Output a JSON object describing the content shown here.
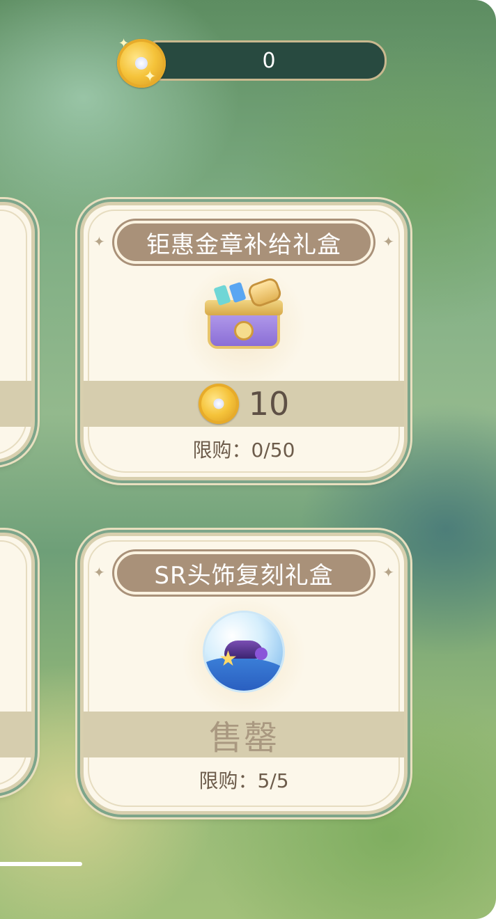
{
  "currency": {
    "balance": "0",
    "icon": "gold-coin-icon"
  },
  "shop": {
    "items": [
      {
        "title": "钜惠金章补给礼盒",
        "icon": "treasure-chest-icon",
        "price": "10",
        "price_icon": "gold-coin-icon",
        "limit_text": "限购：0/50",
        "sold_out": false
      },
      {
        "title": "SR头饰复刻礼盒",
        "icon": "headwear-orb-icon",
        "status_text": "售罄",
        "limit_text": "限购：5/5",
        "sold_out": true
      }
    ]
  },
  "colors": {
    "card_background": "#fcf7ea",
    "title_pill": "#a99179",
    "price_band": "#d6cdae",
    "currency_bar": "#284a40"
  }
}
